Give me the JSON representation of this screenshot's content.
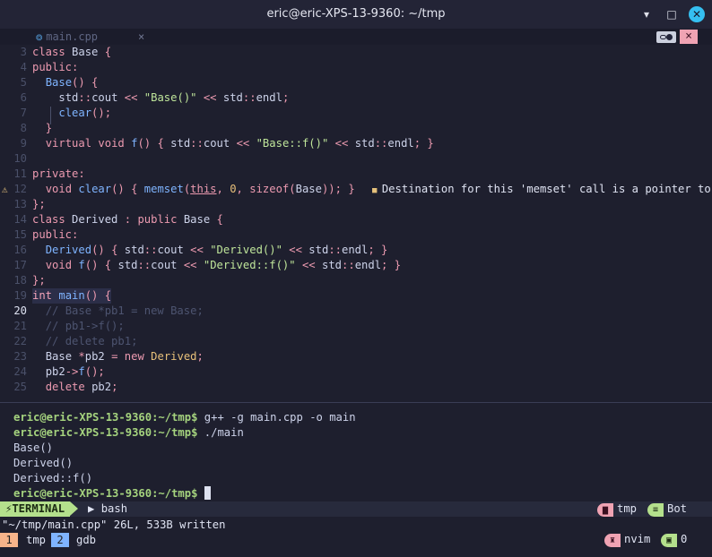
{
  "window": {
    "title": "eric@eric-XPS-13-9360: ~/tmp",
    "minimize": "▾",
    "maximize": "□",
    "close": "✕"
  },
  "tabline": {
    "file": "main.cpp",
    "close": "×",
    "close_btn": "×"
  },
  "code": {
    "current_line": 20,
    "lines": [
      {
        "n": "3",
        "html": "<span class=\"k\">class</span> <span class=\"w\">Base</span> <span class=\"k\">{</span>"
      },
      {
        "n": "4",
        "html": "<span class=\"k\">public:</span>"
      },
      {
        "n": "5",
        "html": "  <span class=\"fn\">Base</span><span class=\"k\">() {</span>"
      },
      {
        "n": "6",
        "html": "    <span class=\"w\">std</span><span class=\"k\">::</span><span class=\"w\">cout</span> <span class=\"k\">&lt;&lt;</span> <span class=\"s\">\"Base()\"</span> <span class=\"k\">&lt;&lt;</span> <span class=\"w\">std</span><span class=\"k\">::</span><span class=\"w\">endl</span><span class=\"k\">;</span>"
      },
      {
        "n": "7",
        "html": "    <span class=\"fn\">clear</span><span class=\"k\">();</span>"
      },
      {
        "n": "8",
        "html": "  <span class=\"k\">}</span>"
      },
      {
        "n": "9",
        "html": "  <span class=\"k\">virtual</span> <span class=\"k\">void</span> <span class=\"fn\">f</span><span class=\"k\">() {</span> <span class=\"w\">std</span><span class=\"k\">::</span><span class=\"w\">cout</span> <span class=\"k\">&lt;&lt;</span> <span class=\"s\">\"Base::f()\"</span> <span class=\"k\">&lt;&lt;</span> <span class=\"w\">std</span><span class=\"k\">::</span><span class=\"w\">endl</span><span class=\"k\">; }</span>"
      },
      {
        "n": "10",
        "html": ""
      },
      {
        "n": "11",
        "html": "<span class=\"k\">private:</span>"
      },
      {
        "n": "12",
        "html": "  <span class=\"k\">void</span> <span class=\"fn\">clear</span><span class=\"k\">() {</span> <span class=\"fn\">memset</span><span class=\"k\">(</span><span class=\"k u\">this</span><span class=\"k\">,</span> <span class=\"n\">0</span><span class=\"k\">,</span> <span class=\"k\">sizeof</span><span class=\"k\">(</span><span class=\"w\">Base</span><span class=\"k\">)); }</span>",
        "warn": true
      },
      {
        "n": "13",
        "html": "<span class=\"k\">};</span>"
      },
      {
        "n": "14",
        "html": "<span class=\"k\">class</span> <span class=\"w\">Derived</span> <span class=\"k\">:</span> <span class=\"k\">public</span> <span class=\"w\">Base</span> <span class=\"k\">{</span>"
      },
      {
        "n": "15",
        "html": "<span class=\"k\">public:</span>"
      },
      {
        "n": "16",
        "html": "  <span class=\"fn\">Derived</span><span class=\"k\">() {</span> <span class=\"w\">std</span><span class=\"k\">::</span><span class=\"w\">cout</span> <span class=\"k\">&lt;&lt;</span> <span class=\"s\">\"Derived()\"</span> <span class=\"k\">&lt;&lt;</span> <span class=\"w\">std</span><span class=\"k\">::</span><span class=\"w\">endl</span><span class=\"k\">; }</span>"
      },
      {
        "n": "17",
        "html": "  <span class=\"k\">void</span> <span class=\"fn\">f</span><span class=\"k\">() {</span> <span class=\"w\">std</span><span class=\"k\">::</span><span class=\"w\">cout</span> <span class=\"k\">&lt;&lt;</span> <span class=\"s\">\"Derived::f()\"</span> <span class=\"k\">&lt;&lt;</span> <span class=\"w\">std</span><span class=\"k\">::</span><span class=\"w\">endl</span><span class=\"k\">; }</span>"
      },
      {
        "n": "18",
        "html": "<span class=\"k\">};</span>"
      },
      {
        "n": "19",
        "html": "<span class=\"t\">int</span> <span class=\"fn\">main</span><span class=\"k\">() {</span>",
        "hl": true
      },
      {
        "n": "20",
        "html": "  <span class=\"c\">// Base *pb1 = new Base;</span>"
      },
      {
        "n": "21",
        "html": "  <span class=\"c\">// pb1-&gt;f();</span>"
      },
      {
        "n": "22",
        "html": "  <span class=\"c\">// delete pb1;</span>"
      },
      {
        "n": "23",
        "html": "  <span class=\"w\">Base</span> <span class=\"k\">*</span><span class=\"w\">pb2</span> <span class=\"k\">=</span> <span class=\"k\">new</span> <span class=\"n\">Derived</span><span class=\"k\">;</span>"
      },
      {
        "n": "24",
        "html": "  <span class=\"w\">pb2</span><span class=\"k\">-&gt;</span><span class=\"fn\">f</span><span class=\"k\">();</span>"
      },
      {
        "n": "25",
        "html": "  <span class=\"k\">delete</span> <span class=\"w\">pb2</span><span class=\"k\">;</span>"
      }
    ],
    "diagnostic": "Destination for this 'memset' call is a pointer to",
    "warning_sign": "⚠"
  },
  "terminal": {
    "prompt": "eric@eric-XPS-13-9360:~/tmp$",
    "lines": [
      {
        "prompt": true,
        "cmd": " g++ -g main.cpp -o main"
      },
      {
        "prompt": true,
        "cmd": " ./main"
      },
      {
        "prompt": false,
        "cmd": "Base()"
      },
      {
        "prompt": false,
        "cmd": "Derived()"
      },
      {
        "prompt": false,
        "cmd": "Derived::f()"
      },
      {
        "prompt": true,
        "cmd": " ",
        "cursor": true
      }
    ]
  },
  "statusline": {
    "mode": "TERMINAL",
    "mode_icon": "⚡",
    "shell_icon": "▶",
    "shell": "bash",
    "dir": "tmp",
    "position": "Bot",
    "dir_icon": "▆",
    "pos_icon": "≡"
  },
  "cmdline": "\"~/tmp/main.cpp\" 26L, 533B written",
  "tmux": {
    "windows": [
      {
        "num": "1",
        "name": "tmp"
      },
      {
        "num": "2",
        "name": "gdb"
      }
    ],
    "session": "nvim",
    "pane": "0",
    "session_icon": "♜",
    "pane_icon": "▣"
  }
}
